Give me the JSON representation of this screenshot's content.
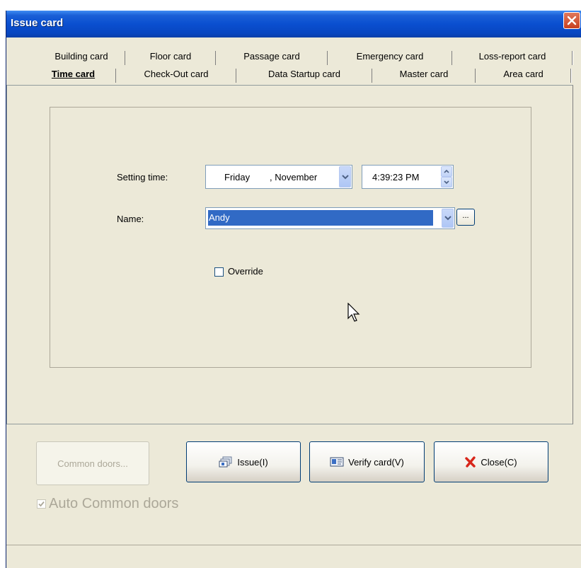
{
  "window": {
    "title": "Issue card"
  },
  "tabs": {
    "row_back": [
      "Building card",
      "Floor card",
      "Passage card",
      "Emergency card",
      "Loss-report card"
    ],
    "row_front": [
      "Time card",
      "Check-Out card",
      "Data Startup card",
      "Master card",
      "Area card"
    ],
    "active": "Time card"
  },
  "form": {
    "setting_time_label": "Setting time:",
    "date_day": "Friday",
    "date_month": ", November",
    "time_value": "4:39:23 PM",
    "name_label": "Name:",
    "name_value": "Andy",
    "browse_label": "...",
    "override_label": "Override",
    "override_checked": false
  },
  "buttons": {
    "common_doors": "Common doors...",
    "issue": "Issue(I)",
    "verify": "Verify card(V)",
    "close": "Close(C)"
  },
  "auto_common_doors": {
    "label": "Auto Common doors",
    "checked": true
  },
  "colors": {
    "titlebar": "#0a4fd0",
    "selection": "#316ac5",
    "close_red": "#c8401f"
  },
  "icons": [
    "close-icon",
    "dropdown-arrow-icon",
    "spin-up-icon",
    "spin-down-icon",
    "card-stack-icon",
    "id-card-icon",
    "red-x-icon",
    "mouse-cursor-icon",
    "checkmark-icon"
  ]
}
